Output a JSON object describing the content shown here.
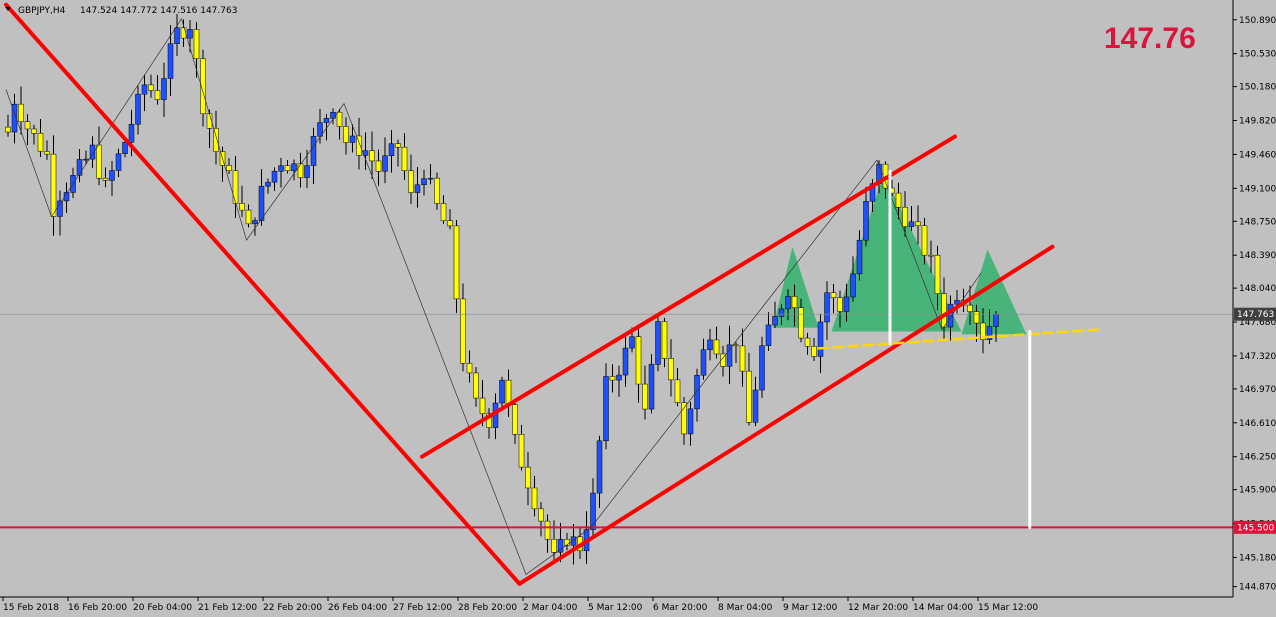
{
  "header": {
    "symbol_label": "GBPJPY,H4",
    "ohlc_text": "147.524 147.772 147.516 147.763",
    "big_price": "147.76"
  },
  "colors": {
    "background": "#c0c0c0",
    "bull_body": "#1e50ff",
    "bear_body": "#ffff00",
    "wick": "#000000",
    "trendline": "#ff0000",
    "support": "#dc143c",
    "pattern_fill": "#3cb371",
    "neckline": "#ffd700",
    "target_line": "#ffffff",
    "price_tag_bg": "#404040",
    "support_tag_bg": "#dc143c"
  },
  "chart_data": {
    "type": "candlestick",
    "symbol": "GBPJPY",
    "timeframe": "H4",
    "ylim": [
      144.76,
      151.1
    ],
    "xlim": [
      0,
      152
    ],
    "y_ticks": [
      "150.890",
      "150.530",
      "150.180",
      "149.820",
      "149.460",
      "149.100",
      "148.750",
      "148.390",
      "148.040",
      "147.680",
      "147.320",
      "146.970",
      "146.610",
      "146.250",
      "145.900",
      "145.540",
      "145.180",
      "144.870"
    ],
    "y_tick_values": [
      150.89,
      150.53,
      150.18,
      149.82,
      149.46,
      149.1,
      148.75,
      148.39,
      148.04,
      147.68,
      147.32,
      146.97,
      146.61,
      146.25,
      145.9,
      145.54,
      145.18,
      144.87
    ],
    "x_ticks": [
      {
        "label": "15 Feb 2018",
        "bar": 0
      },
      {
        "label": "16 Feb 20:00",
        "bar": 10
      },
      {
        "label": "20 Feb 04:00",
        "bar": 20
      },
      {
        "label": "21 Feb 12:00",
        "bar": 30
      },
      {
        "label": "22 Feb 20:00",
        "bar": 40
      },
      {
        "label": "26 Feb 04:00",
        "bar": 50
      },
      {
        "label": "27 Feb 12:00",
        "bar": 60
      },
      {
        "label": "28 Feb 20:00",
        "bar": 70
      },
      {
        "label": "2 Mar 04:00",
        "bar": 80
      },
      {
        "label": "5 Mar 12:00",
        "bar": 90
      },
      {
        "label": "6 Mar 20:00",
        "bar": 100
      },
      {
        "label": "8 Mar 04:00",
        "bar": 110
      },
      {
        "label": "9 Mar 12:00",
        "bar": 120
      },
      {
        "label": "12 Mar 20:00",
        "bar": 130
      },
      {
        "label": "14 Mar 04:00",
        "bar": 140
      },
      {
        "label": "15 Mar 12:00",
        "bar": 150
      }
    ],
    "current_price": 147.763,
    "current_price_label": "147.763",
    "support_level": 145.5,
    "support_label": "145.500",
    "close_path": [
      [
        0,
        149.7
      ],
      [
        1,
        150.05
      ],
      [
        3,
        149.75
      ],
      [
        6,
        149.45
      ],
      [
        7,
        148.9
      ],
      [
        8,
        149.05
      ],
      [
        10,
        149.2
      ],
      [
        13,
        149.5
      ],
      [
        15,
        149.1
      ],
      [
        18,
        149.6
      ],
      [
        20,
        150.0
      ],
      [
        21,
        150.2
      ],
      [
        23,
        150.1
      ],
      [
        26,
        150.75
      ],
      [
        28,
        150.85
      ],
      [
        30,
        150.0
      ],
      [
        32,
        149.5
      ],
      [
        34,
        149.2
      ],
      [
        37,
        148.65
      ],
      [
        39,
        149.05
      ],
      [
        42,
        149.4
      ],
      [
        45,
        149.3
      ],
      [
        48,
        149.75
      ],
      [
        50,
        150.0
      ],
      [
        52,
        149.6
      ],
      [
        55,
        149.5
      ],
      [
        57,
        149.3
      ],
      [
        60,
        149.55
      ],
      [
        62,
        149.0
      ],
      [
        64,
        149.3
      ],
      [
        66,
        148.9
      ],
      [
        68,
        148.6
      ],
      [
        70,
        147.3
      ],
      [
        72,
        146.8
      ],
      [
        74,
        146.65
      ],
      [
        76,
        147.1
      ],
      [
        78,
        146.4
      ],
      [
        80,
        146.0
      ],
      [
        82,
        145.6
      ],
      [
        84,
        145.15
      ],
      [
        86,
        145.4
      ],
      [
        88,
        145.3
      ],
      [
        90,
        145.8
      ],
      [
        92,
        147.0
      ],
      [
        94,
        147.2
      ],
      [
        96,
        147.5
      ],
      [
        98,
        146.7
      ],
      [
        100,
        147.6
      ],
      [
        102,
        147.1
      ],
      [
        104,
        146.5
      ],
      [
        106,
        147.1
      ],
      [
        108,
        147.6
      ],
      [
        110,
        147.3
      ],
      [
        112,
        147.5
      ],
      [
        114,
        146.6
      ],
      [
        116,
        147.4
      ],
      [
        118,
        147.7
      ],
      [
        120,
        148.05
      ],
      [
        122,
        147.6
      ],
      [
        124,
        147.4
      ],
      [
        126,
        148.0
      ],
      [
        128,
        147.8
      ],
      [
        130,
        148.2
      ],
      [
        132,
        148.9
      ],
      [
        134,
        149.3
      ],
      [
        136,
        149.0
      ],
      [
        138,
        148.8
      ],
      [
        140,
        148.6
      ],
      [
        142,
        148.3
      ],
      [
        144,
        147.7
      ],
      [
        146,
        148.0
      ],
      [
        148,
        147.9
      ],
      [
        150,
        147.55
      ],
      [
        152,
        147.76
      ]
    ],
    "annotations": {
      "downtrend_line": [
        [
          0,
          151.05
        ],
        [
          79,
          144.9
        ]
      ],
      "channel_upper": [
        [
          64,
          146.25
        ],
        [
          146,
          149.65
        ]
      ],
      "channel_lower": [
        [
          79,
          144.9
        ],
        [
          161,
          148.48
        ]
      ],
      "neckline": [
        [
          125,
          147.4
        ],
        [
          168,
          147.6
        ]
      ],
      "target_line": [
        [
          157.5,
          147.58
        ],
        [
          157.5,
          145.5
        ]
      ],
      "head_measure": [
        [
          136,
          149.28
        ],
        [
          136,
          147.45
        ]
      ],
      "zigzag": [
        [
          0,
          150.15
        ],
        [
          7,
          148.8
        ],
        [
          27,
          150.9
        ],
        [
          37,
          148.55
        ],
        [
          52,
          150.0
        ],
        [
          80,
          145.0
        ],
        [
          90,
          145.5
        ],
        [
          134,
          149.4
        ],
        [
          144,
          147.6
        ],
        [
          150,
          148.2
        ]
      ],
      "pattern_left_shoulder": [
        [
          118,
          147.62
        ],
        [
          121,
          148.48
        ],
        [
          125,
          147.62
        ]
      ],
      "pattern_head": [
        [
          127,
          147.58
        ],
        [
          135,
          149.25
        ],
        [
          147,
          147.58
        ]
      ],
      "pattern_right_shoulder": [
        [
          147,
          147.55
        ],
        [
          151,
          148.45
        ],
        [
          157,
          147.55
        ]
      ]
    }
  }
}
